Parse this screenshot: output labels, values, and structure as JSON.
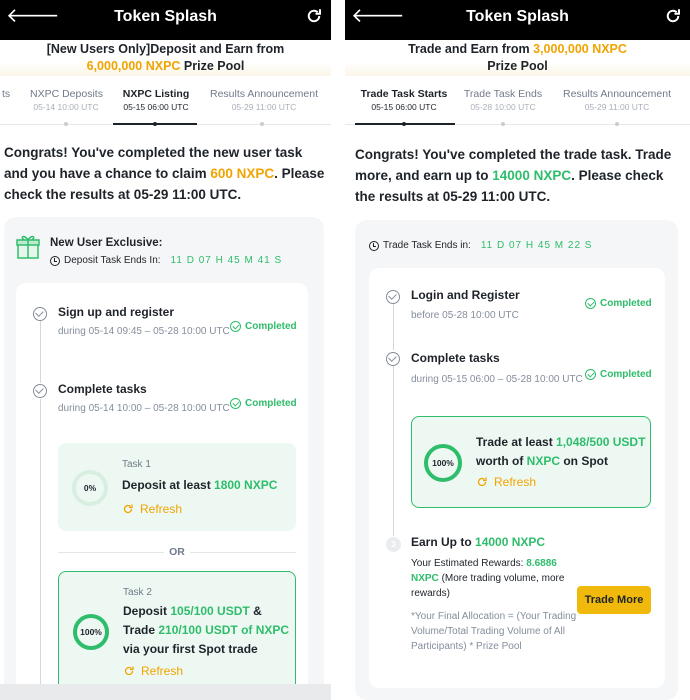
{
  "header": {
    "title": "Token Splash"
  },
  "left": {
    "banner_line1": "[New Users Only]Deposit and Earn from",
    "banner_amount": "6,000,000 NXPC",
    "banner_suffix": "Prize Pool",
    "tabs": [
      {
        "label": "ts",
        "date": ""
      },
      {
        "label": "NXPC Deposits",
        "date": "05-14 10:00 UTC"
      },
      {
        "label": "NXPC Listing",
        "date": "05-15 06:00 UTC"
      },
      {
        "label": "Results Announcement",
        "date": "05-29 11:00 UTC"
      }
    ],
    "congrats_a": "Congrats! You've completed the new user task and you have a chance to claim ",
    "congrats_amount": "600 NXPC",
    "congrats_b": ". Please check the results at 05-29 11:00 UTC.",
    "exclusive_title": "New User Exclusive:",
    "timer_label": "Deposit Task Ends In:",
    "countdown": "11 D  07 H  45 M  41 S",
    "steps": [
      {
        "title": "Sign up and register",
        "sub": "during 05-14 09:45 – 05-28 10:00 UTC",
        "status": "Completed"
      },
      {
        "title": "Complete tasks",
        "sub": "during 05-14 10:00 – 05-28 10:00 UTC",
        "status": "Completed"
      }
    ],
    "task1": {
      "label": "Task 1",
      "progress": "0%",
      "text_a": "Deposit at least ",
      "amount": "1800 NXPC",
      "refresh": "Refresh"
    },
    "or": "OR",
    "task2": {
      "label": "Task 2",
      "progress": "100%",
      "text_a": "Deposit ",
      "deposit": "105/100 USDT",
      "text_b": " & Trade ",
      "trade": "210/100 USDT of NXPC",
      "text_c": " via your first Spot trade",
      "refresh": "Refresh"
    }
  },
  "right": {
    "banner_a": "Trade and Earn from ",
    "banner_amount": "3,000,000 NXPC",
    "banner_suffix": "Prize Pool",
    "tabs": [
      {
        "label": "Trade Task Starts",
        "date": "05-15 06:00 UTC"
      },
      {
        "label": "Trade Task Ends",
        "date": "05-28 10:00 UTC"
      },
      {
        "label": "Results Announcement",
        "date": "05-29 11:00 UTC"
      }
    ],
    "congrats_a": "Congrats! You've completed the trade task. Trade more, and earn up to ",
    "congrats_amount": "14000 NXPC",
    "congrats_b": ". Please check the results at 05-29 11:00 UTC.",
    "timer_label": "Trade Task Ends in:",
    "countdown": "11 D  07 H  45 M  22 S",
    "steps": [
      {
        "title": "Login and Register",
        "sub": "before 05-28 10:00 UTC",
        "status": "Completed"
      },
      {
        "title": "Complete tasks",
        "sub": "during 05-15 06:00 – 05-28 10:00 UTC",
        "status": "Completed"
      }
    ],
    "task": {
      "progress": "100%",
      "text_a": "Trade at least ",
      "amount": "1,048/500 USDT",
      "text_b": " worth of ",
      "token": "NXPC",
      "text_c": " on Spot",
      "refresh": "Refresh"
    },
    "step3": {
      "num": "3",
      "title_a": "Earn Up to ",
      "title_amount": "14000 NXPC",
      "est_a": "Your Estimated Rewards: ",
      "est_amount": "8.6886 NXPC",
      "est_b": " (More trading volume, more rewards)",
      "note": "*Your Final Allocation = (Your Trading Volume/Total Trading Volume of All Participants) * Prize Pool",
      "button": "Trade More"
    }
  },
  "colors": {
    "green": "#2ebd6b",
    "gold": "#f0a400",
    "button": "#f0b90b"
  }
}
